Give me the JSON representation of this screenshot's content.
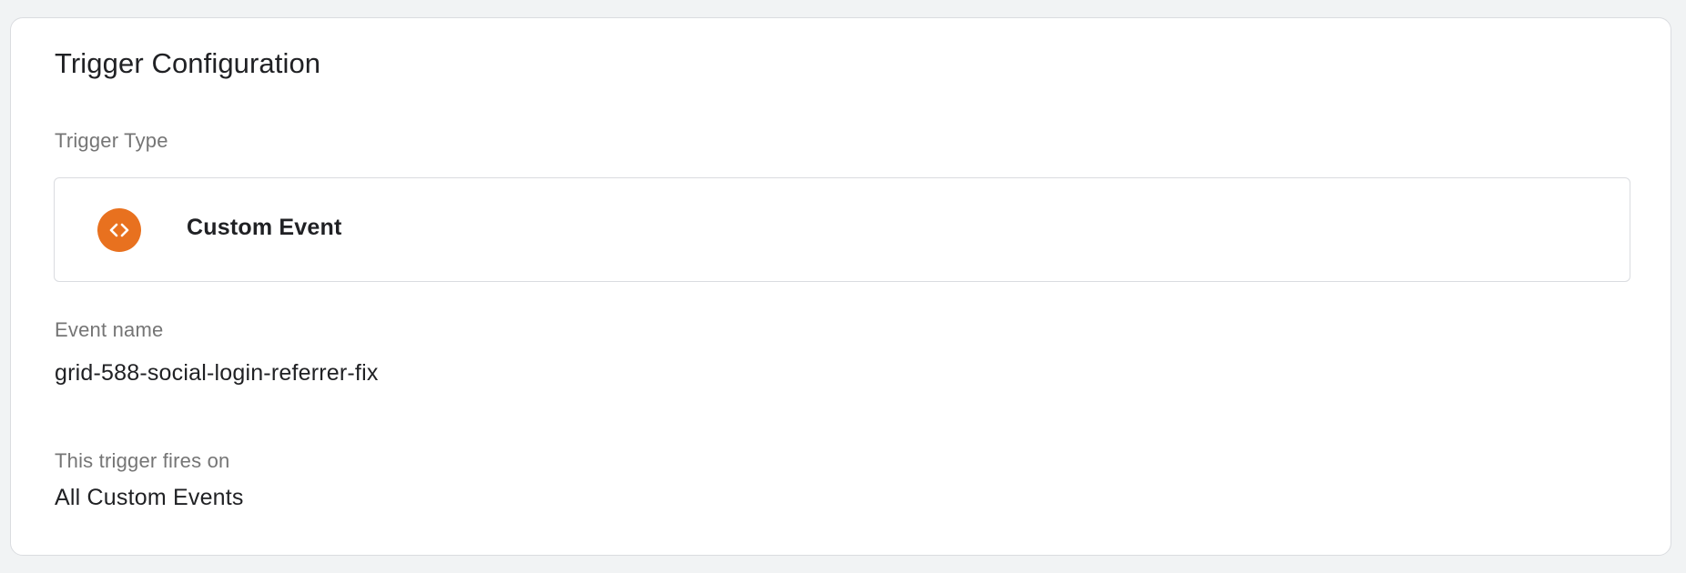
{
  "card": {
    "title": "Trigger Configuration"
  },
  "trigger_type": {
    "label": "Trigger Type",
    "value": "Custom Event",
    "icon": "code-brackets-icon",
    "icon_color": "#e8711f"
  },
  "event_name": {
    "label": "Event name",
    "value": "grid-588-social-login-referrer-fix"
  },
  "fires_on": {
    "label": "This trigger fires on",
    "value": "All Custom Events"
  }
}
